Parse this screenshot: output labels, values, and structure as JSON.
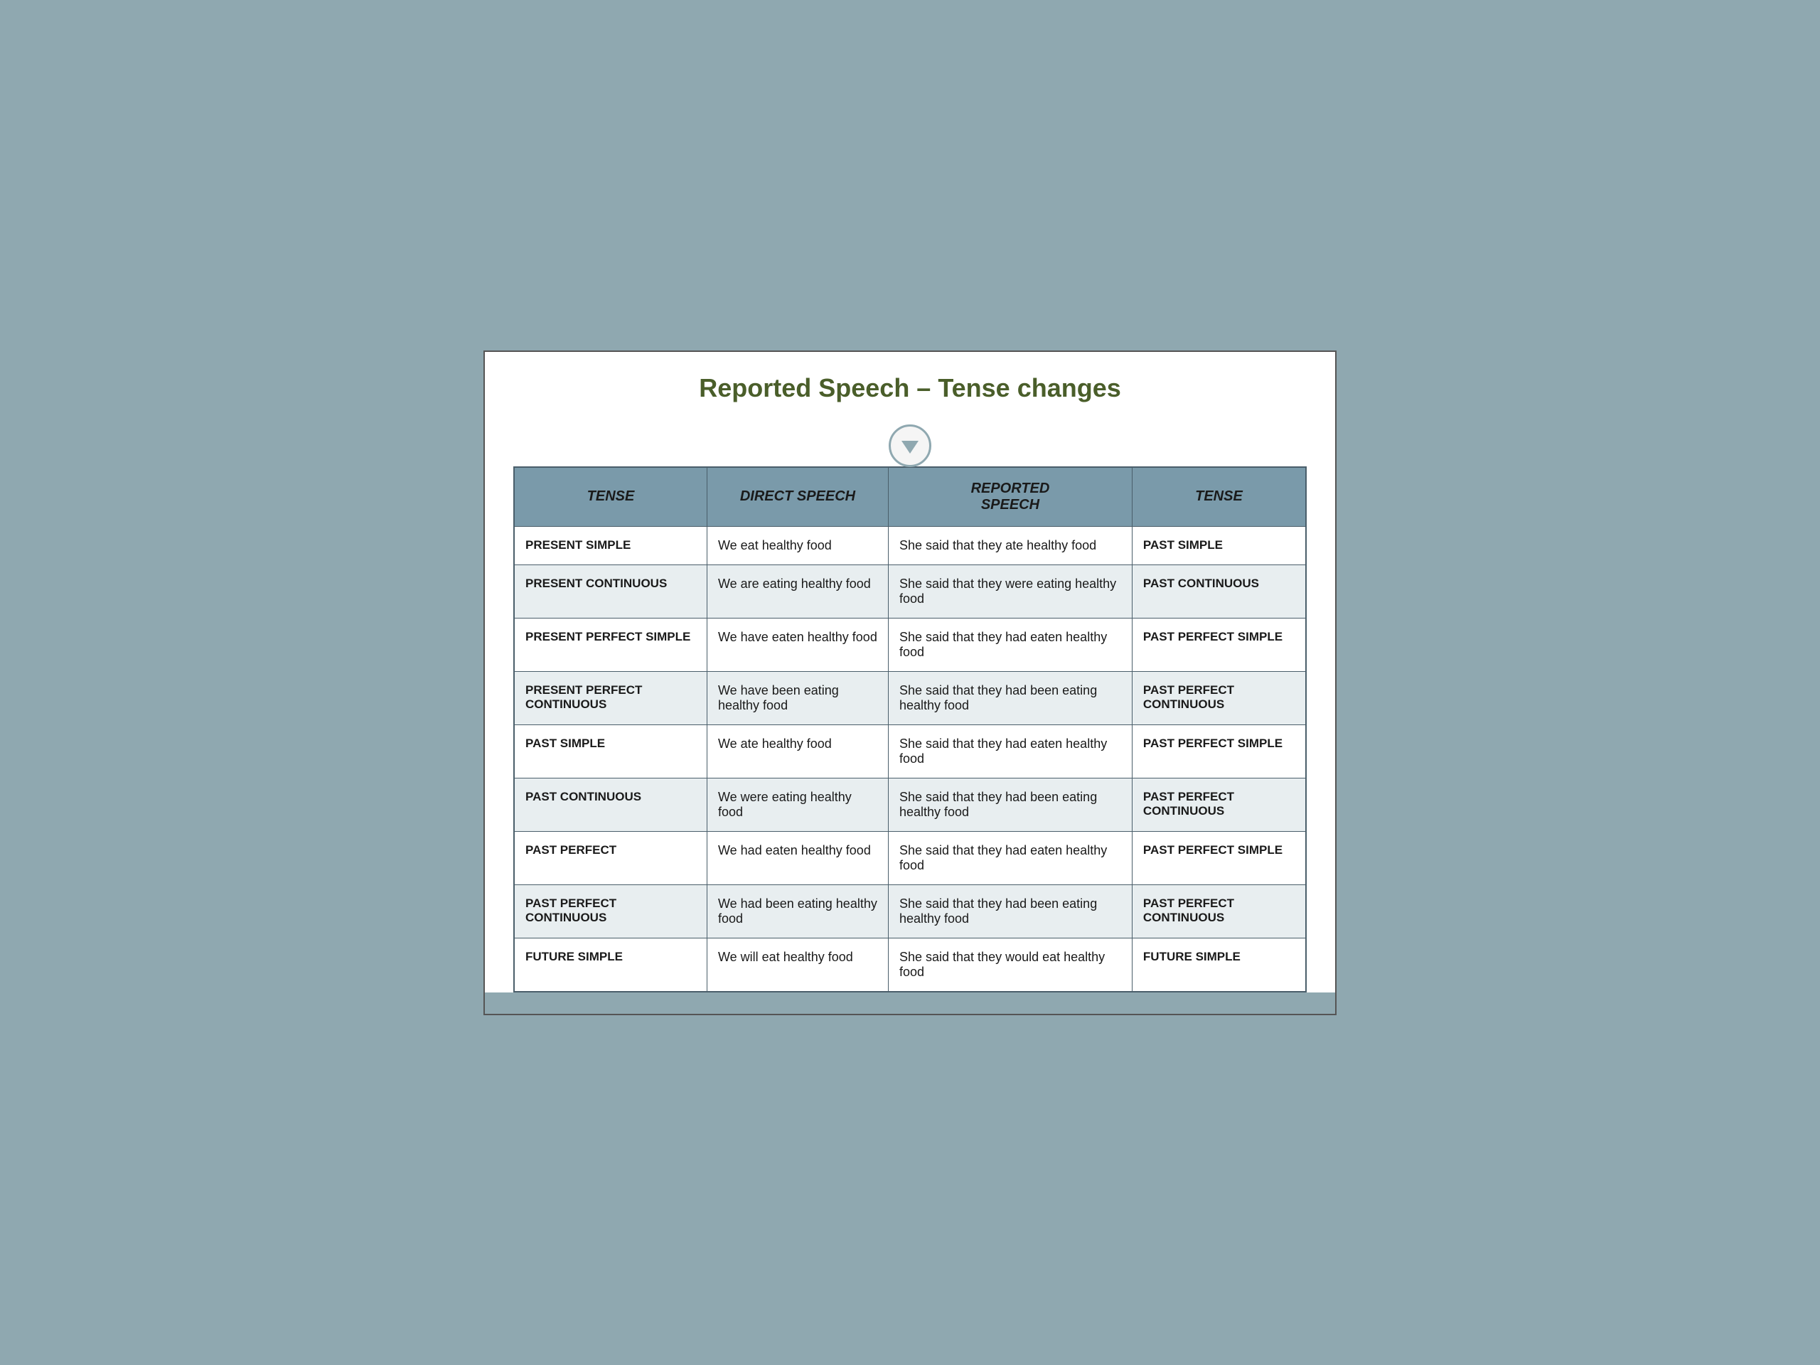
{
  "title": "Reported Speech – Tense changes",
  "table": {
    "headers": [
      "TENSE",
      "DIRECT SPEECH",
      "REPORTED SPEECH",
      "TENSE"
    ],
    "rows": [
      {
        "tense": "PRESENT SIMPLE",
        "direct": "We eat healthy food",
        "reported": "She said that they ate healthy food",
        "result_tense": "PAST SIMPLE"
      },
      {
        "tense": "PRESENT CONTINUOUS",
        "direct": "We are eating healthy food",
        "reported": "She said that they were eating healthy food",
        "result_tense": "PAST CONTINUOUS"
      },
      {
        "tense": "PRESENT PERFECT SIMPLE",
        "direct": "We have eaten healthy food",
        "reported": "She said that they had eaten healthy food",
        "result_tense": "PAST PERFECT SIMPLE"
      },
      {
        "tense": "PRESENT PERFECT CONTINUOUS",
        "direct": "We have been eating healthy food",
        "reported": "She said that they had been eating  healthy food",
        "result_tense": "PAST PERFECT CONTINUOUS"
      },
      {
        "tense": "PAST SIMPLE",
        "direct": "We ate healthy food",
        "reported": "She said that they had eaten healthy food",
        "result_tense": "PAST PERFECT SIMPLE"
      },
      {
        "tense": "PAST CONTINUOUS",
        "direct": "We were eating healthy food",
        "reported": "She said that they had been eating healthy food",
        "result_tense": "PAST PERFECT CONTINUOUS"
      },
      {
        "tense": "PAST PERFECT",
        "direct": "We had eaten healthy food",
        "reported": "She said that they had eaten healthy food",
        "result_tense": "PAST PERFECT SIMPLE"
      },
      {
        "tense": "PAST PERFECT CONTINUOUS",
        "direct": "We had been eating healthy food",
        "reported": "She said that they had been eating  healthy food",
        "result_tense": "PAST PERFECT CONTINUOUS"
      },
      {
        "tense": "FUTURE SIMPLE",
        "direct": "We will eat healthy food",
        "reported": "She said that they would eat healthy food",
        "result_tense": "FUTURE SIMPLE"
      }
    ]
  }
}
